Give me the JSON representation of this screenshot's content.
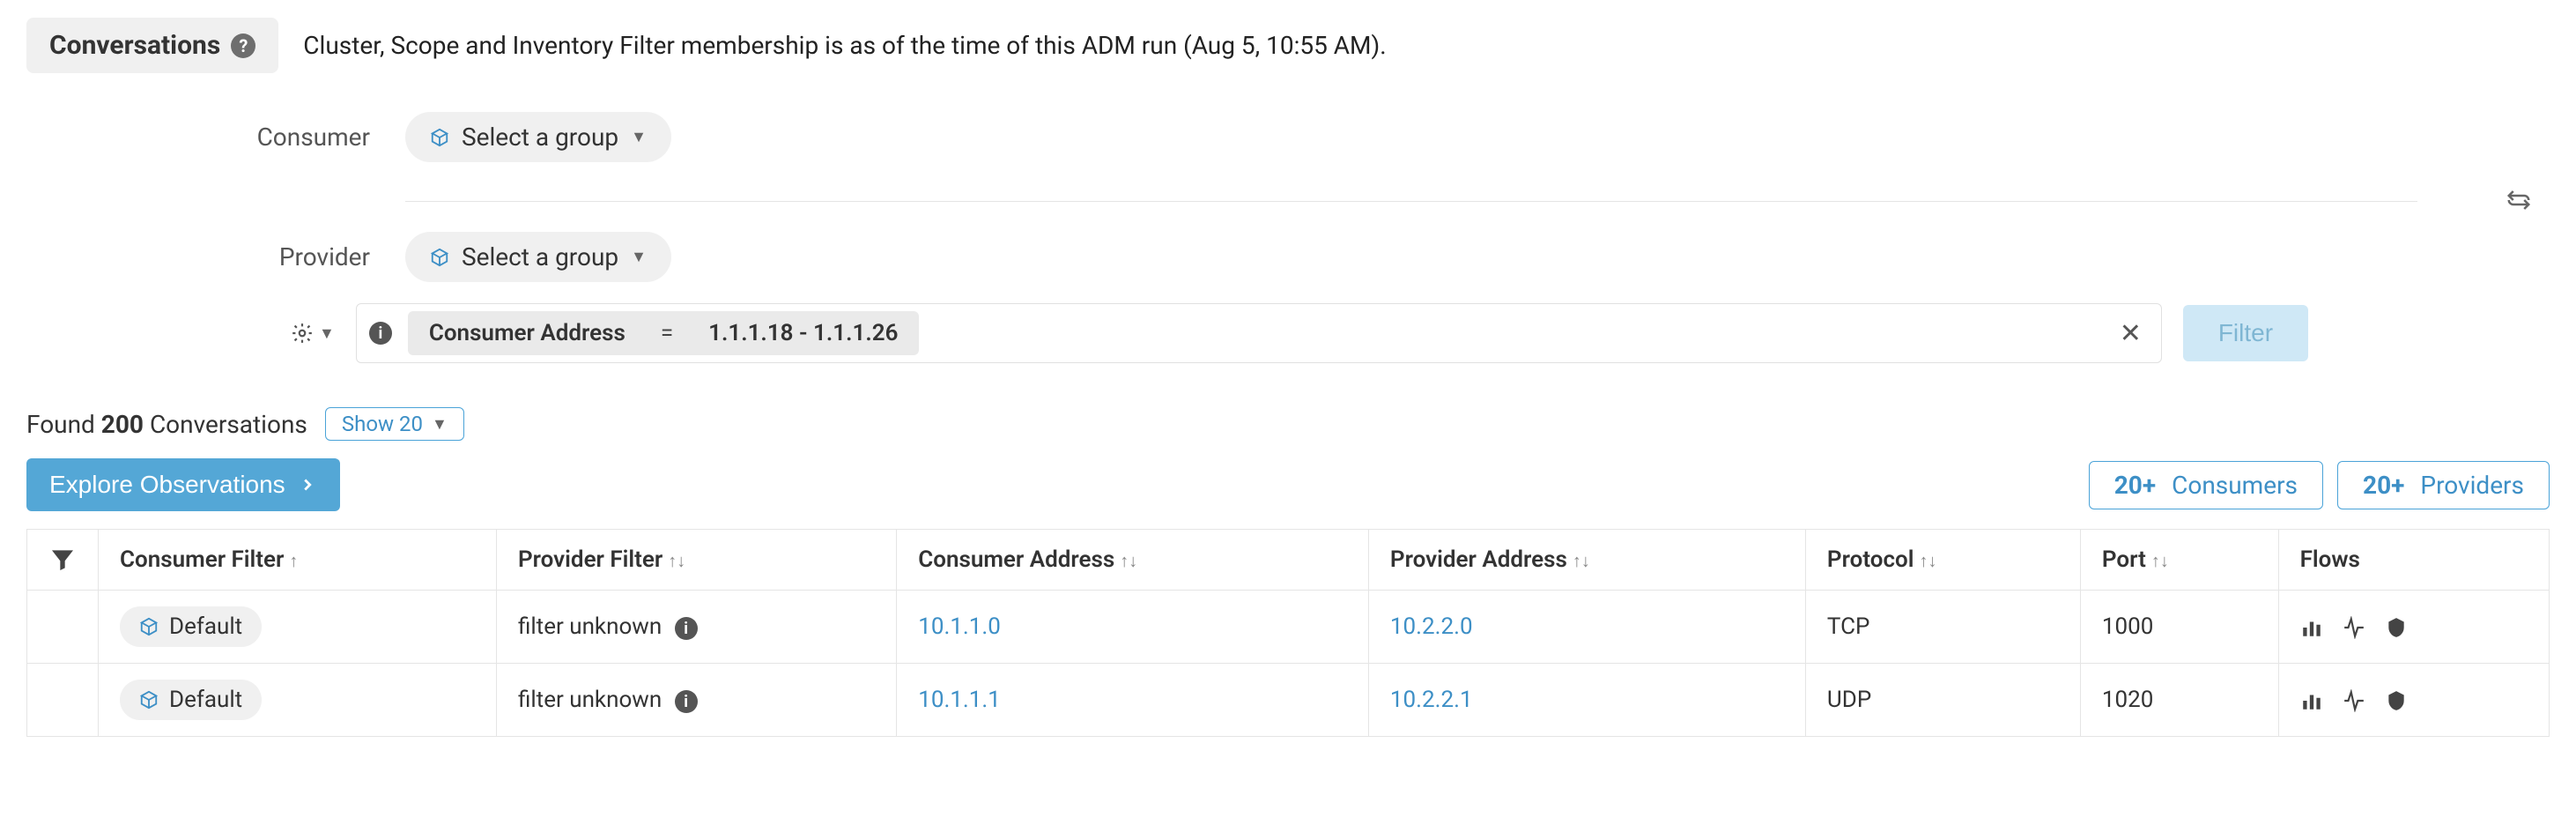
{
  "header": {
    "tab_label": "Conversations",
    "description": "Cluster, Scope and Inventory Filter membership is as of the time of this ADM run (Aug 5, 10:55 AM)."
  },
  "form": {
    "consumer_label": "Consumer",
    "consumer_select": "Select a group",
    "provider_label": "Provider",
    "provider_select": "Select a group"
  },
  "filter_chip": {
    "field": "Consumer Address",
    "op": "=",
    "value": "1.1.1.18 - 1.1.1.26"
  },
  "filter_button": "Filter",
  "results": {
    "found_prefix": "Found ",
    "count": "200",
    "found_suffix": " Conversations",
    "show_label": "Show 20"
  },
  "explore_button": "Explore Observations",
  "summary": {
    "consumers_count": "20+",
    "consumers_label": "Consumers",
    "providers_count": "20+",
    "providers_label": "Providers"
  },
  "columns": {
    "consumer_filter": "Consumer Filter",
    "provider_filter": "Provider Filter",
    "consumer_address": "Consumer Address",
    "provider_address": "Provider Address",
    "protocol": "Protocol",
    "port": "Port",
    "flows": "Flows"
  },
  "rows": [
    {
      "consumer_filter": "Default",
      "provider_filter": "filter unknown",
      "consumer_address": "10.1.1.0",
      "provider_address": "10.2.2.0",
      "protocol": "TCP",
      "port": "1000"
    },
    {
      "consumer_filter": "Default",
      "provider_filter": "filter unknown",
      "consumer_address": "10.1.1.1",
      "provider_address": "10.2.2.1",
      "protocol": "UDP",
      "port": "1020"
    }
  ]
}
